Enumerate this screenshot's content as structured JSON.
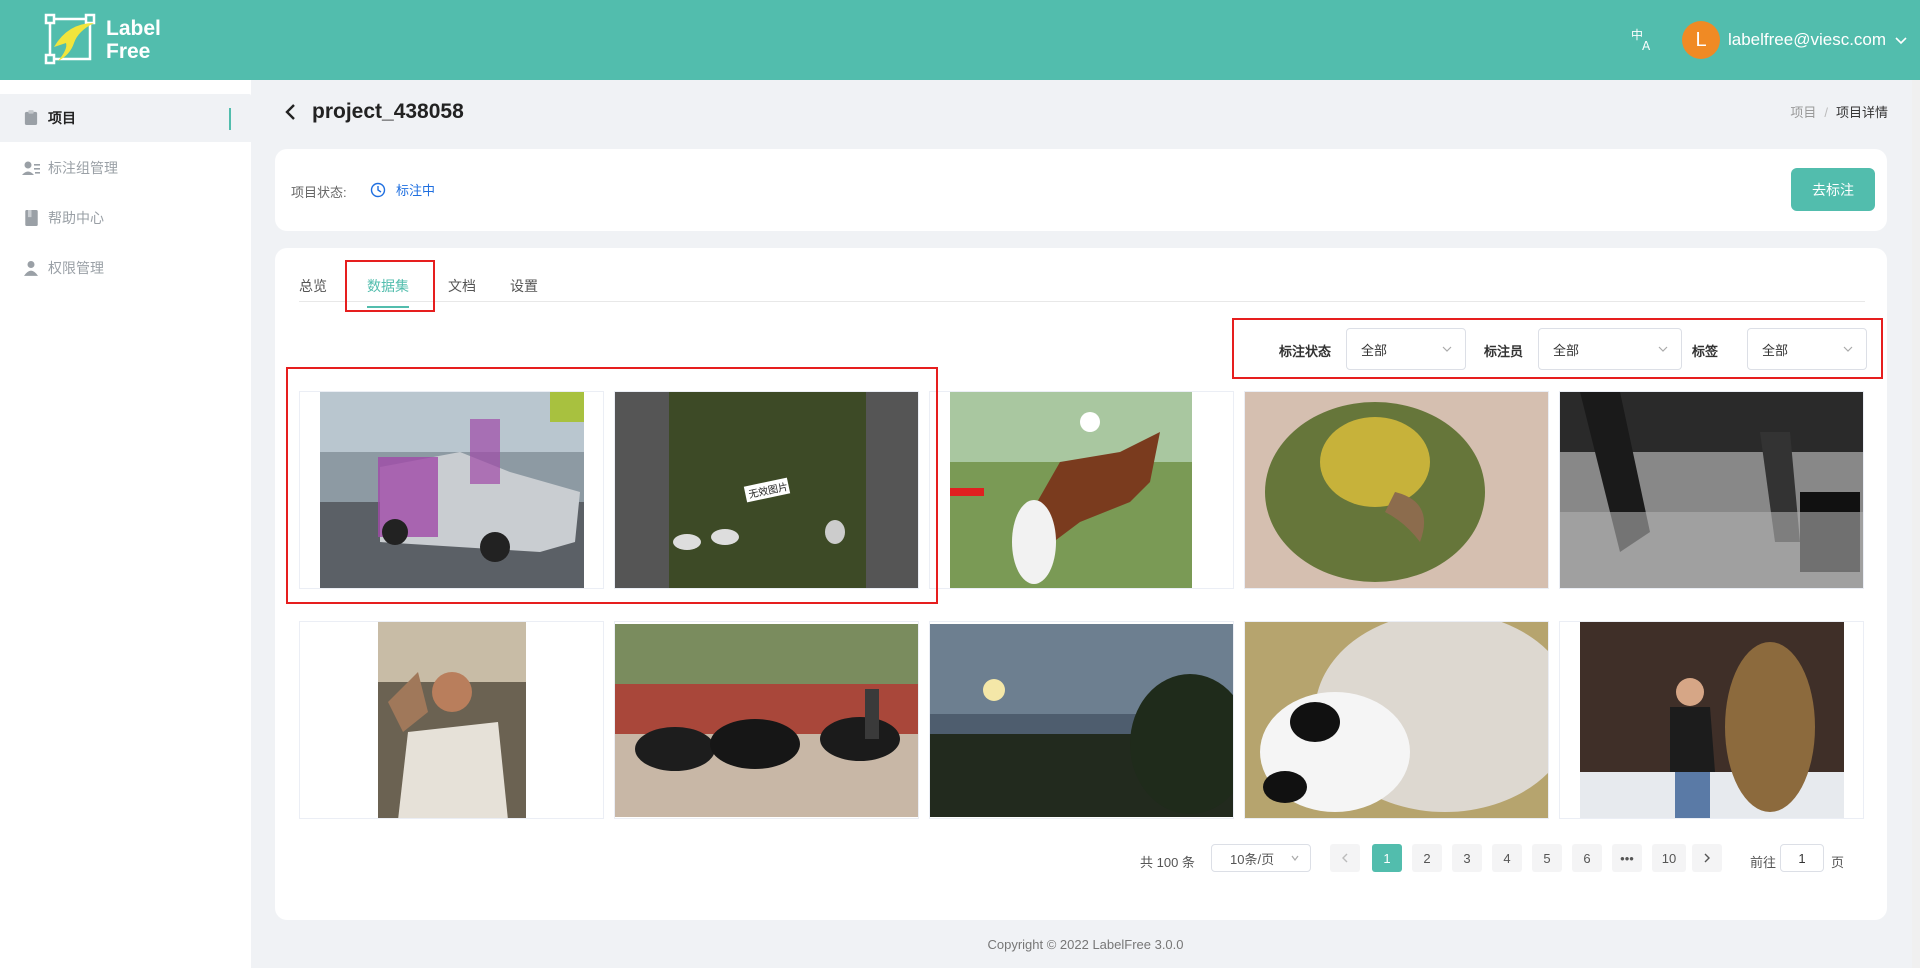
{
  "header": {
    "logo_line1": "Label",
    "logo_line2": "Free",
    "lang_icon": "translate-icon",
    "user_initial": "L",
    "user_email": "labelfree@viesc.com",
    "brand_color": "#52bdad",
    "avatar_color": "#f08a24"
  },
  "sidebar": {
    "items": [
      {
        "label": "项目",
        "icon": "clipboard-icon"
      },
      {
        "label": "标注组管理",
        "icon": "users-list-icon"
      },
      {
        "label": "帮助中心",
        "icon": "book-icon"
      },
      {
        "label": "权限管理",
        "icon": "user-icon"
      }
    ]
  },
  "page": {
    "title": "project_438058",
    "breadcrumb": [
      "项目",
      "项目详情"
    ]
  },
  "status": {
    "label": "项目状态:",
    "value": "标注中",
    "action_button": "去标注",
    "value_color": "#1f6fe0"
  },
  "tabs": [
    {
      "label": "总览"
    },
    {
      "label": "数据集"
    },
    {
      "label": "文档"
    },
    {
      "label": "设置"
    }
  ],
  "filters": [
    {
      "label": "标注状态",
      "value": "全部"
    },
    {
      "label": "标注员",
      "value": "全部"
    },
    {
      "label": "标签",
      "value": "全部"
    }
  ],
  "thumbnails": [
    {
      "name": "cars-parking-lot"
    },
    {
      "name": "sheep-field-dark",
      "badge": "无效图片"
    },
    {
      "name": "horse-jumping"
    },
    {
      "name": "parrot-closeup"
    },
    {
      "name": "street-people-bw"
    },
    {
      "name": "man-in-car"
    },
    {
      "name": "water-buffalo-street"
    },
    {
      "name": "sunset-field"
    },
    {
      "name": "sheep-closeup"
    },
    {
      "name": "woman-bear-statue"
    }
  ],
  "pagination": {
    "total": "共 100 条",
    "page_size": "10条/页",
    "pages": [
      "1",
      "2",
      "3",
      "4",
      "5",
      "6",
      "•••",
      "10"
    ],
    "current": "1",
    "goto_label": "前往",
    "goto_value": "1",
    "goto_suffix": "页"
  },
  "footer": {
    "copyright": "Copyright © 2022 LabelFree 3.0.0"
  }
}
